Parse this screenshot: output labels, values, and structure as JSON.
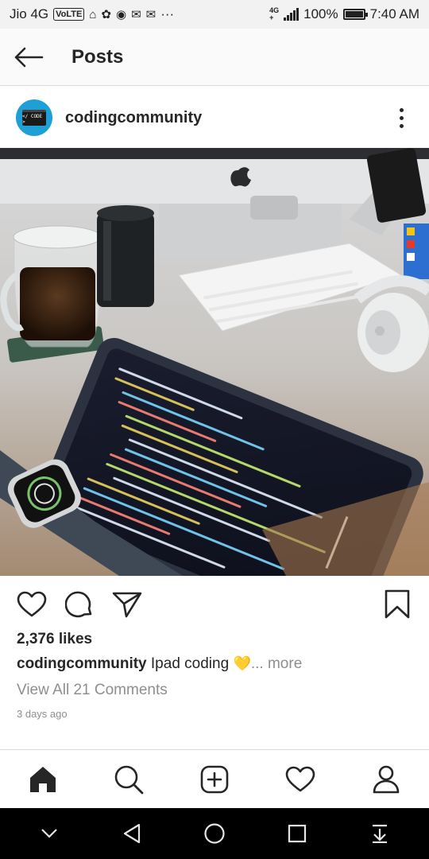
{
  "status_bar": {
    "carrier": "Jio 4G",
    "volte": "VoLTE",
    "network_tag_top": "4G",
    "network_tag_bottom": "+",
    "battery": "100%",
    "battery_level": 1.0,
    "time": "7:40 AM",
    "more": "···"
  },
  "topnav": {
    "title": "Posts",
    "back_icon": "arrow-left-icon"
  },
  "post": {
    "username": "codingcommunity",
    "avatar_text": "</ CODE >",
    "likes": "2,376 likes",
    "caption_user": "codingcommunity",
    "caption_text": " Ipad coding ",
    "caption_emoji": "💛",
    "caption_more": "... more",
    "comments": "View All 21 Comments",
    "time_ago": "3 days ago"
  },
  "icons": {
    "like": "heart-icon",
    "comment": "comment-icon",
    "share": "send-icon",
    "save": "bookmark-icon",
    "home": "home-icon",
    "search": "search-icon",
    "add": "add-post-icon",
    "activity": "heart-icon",
    "profile": "profile-icon"
  },
  "colors": {
    "text": "#262626",
    "muted": "#8e8e8e",
    "avatar": "#1e9fd6",
    "divider": "#dbdbdb"
  }
}
